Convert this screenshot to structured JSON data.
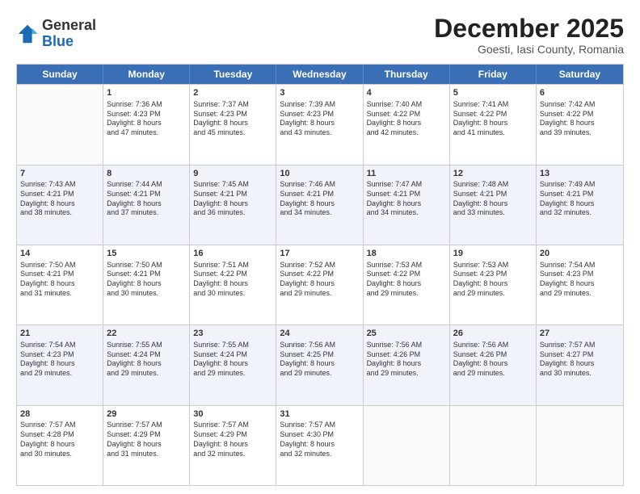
{
  "logo": {
    "general": "General",
    "blue": "Blue"
  },
  "header": {
    "month": "December 2025",
    "location": "Goesti, Iasi County, Romania"
  },
  "days_of_week": [
    "Sunday",
    "Monday",
    "Tuesday",
    "Wednesday",
    "Thursday",
    "Friday",
    "Saturday"
  ],
  "weeks": [
    [
      {
        "day": "",
        "sunrise": "",
        "sunset": "",
        "daylight": ""
      },
      {
        "day": "1",
        "sunrise": "Sunrise: 7:36 AM",
        "sunset": "Sunset: 4:23 PM",
        "daylight": "Daylight: 8 hours and 47 minutes."
      },
      {
        "day": "2",
        "sunrise": "Sunrise: 7:37 AM",
        "sunset": "Sunset: 4:23 PM",
        "daylight": "Daylight: 8 hours and 45 minutes."
      },
      {
        "day": "3",
        "sunrise": "Sunrise: 7:39 AM",
        "sunset": "Sunset: 4:23 PM",
        "daylight": "Daylight: 8 hours and 43 minutes."
      },
      {
        "day": "4",
        "sunrise": "Sunrise: 7:40 AM",
        "sunset": "Sunset: 4:22 PM",
        "daylight": "Daylight: 8 hours and 42 minutes."
      },
      {
        "day": "5",
        "sunrise": "Sunrise: 7:41 AM",
        "sunset": "Sunset: 4:22 PM",
        "daylight": "Daylight: 8 hours and 41 minutes."
      },
      {
        "day": "6",
        "sunrise": "Sunrise: 7:42 AM",
        "sunset": "Sunset: 4:22 PM",
        "daylight": "Daylight: 8 hours and 39 minutes."
      }
    ],
    [
      {
        "day": "7",
        "sunrise": "Sunrise: 7:43 AM",
        "sunset": "Sunset: 4:21 PM",
        "daylight": "Daylight: 8 hours and 38 minutes."
      },
      {
        "day": "8",
        "sunrise": "Sunrise: 7:44 AM",
        "sunset": "Sunset: 4:21 PM",
        "daylight": "Daylight: 8 hours and 37 minutes."
      },
      {
        "day": "9",
        "sunrise": "Sunrise: 7:45 AM",
        "sunset": "Sunset: 4:21 PM",
        "daylight": "Daylight: 8 hours and 36 minutes."
      },
      {
        "day": "10",
        "sunrise": "Sunrise: 7:46 AM",
        "sunset": "Sunset: 4:21 PM",
        "daylight": "Daylight: 8 hours and 34 minutes."
      },
      {
        "day": "11",
        "sunrise": "Sunrise: 7:47 AM",
        "sunset": "Sunset: 4:21 PM",
        "daylight": "Daylight: 8 hours and 34 minutes."
      },
      {
        "day": "12",
        "sunrise": "Sunrise: 7:48 AM",
        "sunset": "Sunset: 4:21 PM",
        "daylight": "Daylight: 8 hours and 33 minutes."
      },
      {
        "day": "13",
        "sunrise": "Sunrise: 7:49 AM",
        "sunset": "Sunset: 4:21 PM",
        "daylight": "Daylight: 8 hours and 32 minutes."
      }
    ],
    [
      {
        "day": "14",
        "sunrise": "Sunrise: 7:50 AM",
        "sunset": "Sunset: 4:21 PM",
        "daylight": "Daylight: 8 hours and 31 minutes."
      },
      {
        "day": "15",
        "sunrise": "Sunrise: 7:50 AM",
        "sunset": "Sunset: 4:21 PM",
        "daylight": "Daylight: 8 hours and 30 minutes."
      },
      {
        "day": "16",
        "sunrise": "Sunrise: 7:51 AM",
        "sunset": "Sunset: 4:22 PM",
        "daylight": "Daylight: 8 hours and 30 minutes."
      },
      {
        "day": "17",
        "sunrise": "Sunrise: 7:52 AM",
        "sunset": "Sunset: 4:22 PM",
        "daylight": "Daylight: 8 hours and 29 minutes."
      },
      {
        "day": "18",
        "sunrise": "Sunrise: 7:53 AM",
        "sunset": "Sunset: 4:22 PM",
        "daylight": "Daylight: 8 hours and 29 minutes."
      },
      {
        "day": "19",
        "sunrise": "Sunrise: 7:53 AM",
        "sunset": "Sunset: 4:23 PM",
        "daylight": "Daylight: 8 hours and 29 minutes."
      },
      {
        "day": "20",
        "sunrise": "Sunrise: 7:54 AM",
        "sunset": "Sunset: 4:23 PM",
        "daylight": "Daylight: 8 hours and 29 minutes."
      }
    ],
    [
      {
        "day": "21",
        "sunrise": "Sunrise: 7:54 AM",
        "sunset": "Sunset: 4:23 PM",
        "daylight": "Daylight: 8 hours and 29 minutes."
      },
      {
        "day": "22",
        "sunrise": "Sunrise: 7:55 AM",
        "sunset": "Sunset: 4:24 PM",
        "daylight": "Daylight: 8 hours and 29 minutes."
      },
      {
        "day": "23",
        "sunrise": "Sunrise: 7:55 AM",
        "sunset": "Sunset: 4:24 PM",
        "daylight": "Daylight: 8 hours and 29 minutes."
      },
      {
        "day": "24",
        "sunrise": "Sunrise: 7:56 AM",
        "sunset": "Sunset: 4:25 PM",
        "daylight": "Daylight: 8 hours and 29 minutes."
      },
      {
        "day": "25",
        "sunrise": "Sunrise: 7:56 AM",
        "sunset": "Sunset: 4:26 PM",
        "daylight": "Daylight: 8 hours and 29 minutes."
      },
      {
        "day": "26",
        "sunrise": "Sunrise: 7:56 AM",
        "sunset": "Sunset: 4:26 PM",
        "daylight": "Daylight: 8 hours and 29 minutes."
      },
      {
        "day": "27",
        "sunrise": "Sunrise: 7:57 AM",
        "sunset": "Sunset: 4:27 PM",
        "daylight": "Daylight: 8 hours and 30 minutes."
      }
    ],
    [
      {
        "day": "28",
        "sunrise": "Sunrise: 7:57 AM",
        "sunset": "Sunset: 4:28 PM",
        "daylight": "Daylight: 8 hours and 30 minutes."
      },
      {
        "day": "29",
        "sunrise": "Sunrise: 7:57 AM",
        "sunset": "Sunset: 4:29 PM",
        "daylight": "Daylight: 8 hours and 31 minutes."
      },
      {
        "day": "30",
        "sunrise": "Sunrise: 7:57 AM",
        "sunset": "Sunset: 4:29 PM",
        "daylight": "Daylight: 8 hours and 32 minutes."
      },
      {
        "day": "31",
        "sunrise": "Sunrise: 7:57 AM",
        "sunset": "Sunset: 4:30 PM",
        "daylight": "Daylight: 8 hours and 32 minutes."
      },
      {
        "day": "",
        "sunrise": "",
        "sunset": "",
        "daylight": ""
      },
      {
        "day": "",
        "sunrise": "",
        "sunset": "",
        "daylight": ""
      },
      {
        "day": "",
        "sunrise": "",
        "sunset": "",
        "daylight": ""
      }
    ]
  ]
}
